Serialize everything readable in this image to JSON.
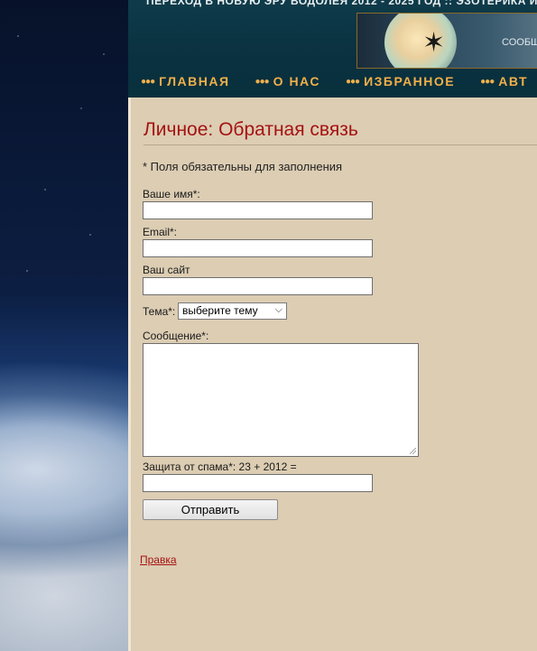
{
  "header": {
    "tagline": "ПЕРЕХОД В НОВУЮ ЭРУ ВОДОЛЕЯ 2012 - 2025 ГОД :: ЭЗОТЕРИКА И",
    "banner_text": "СООБЩ"
  },
  "nav": {
    "items": [
      {
        "label": "ГЛАВНАЯ"
      },
      {
        "label": "О НАС"
      },
      {
        "label": "ИЗБРАННОЕ"
      },
      {
        "label": "АВТ"
      }
    ]
  },
  "page": {
    "title": "Личное: Обратная связь",
    "required_note": "* Поля обязательны для заполнения"
  },
  "form": {
    "name_label": "Ваше имя*:",
    "name_value": "",
    "email_label": "Email*:",
    "email_value": "",
    "site_label": "Ваш сайт",
    "site_value": "",
    "topic_label": "Тема*:",
    "topic_selected": "выберите тему",
    "message_label": "Сообщение*:",
    "captcha_label": "Защита от спама*: 23 + 2012 =",
    "captcha_value": "",
    "submit_label": "Отправить"
  },
  "footer": {
    "edit_link": "Правка"
  }
}
